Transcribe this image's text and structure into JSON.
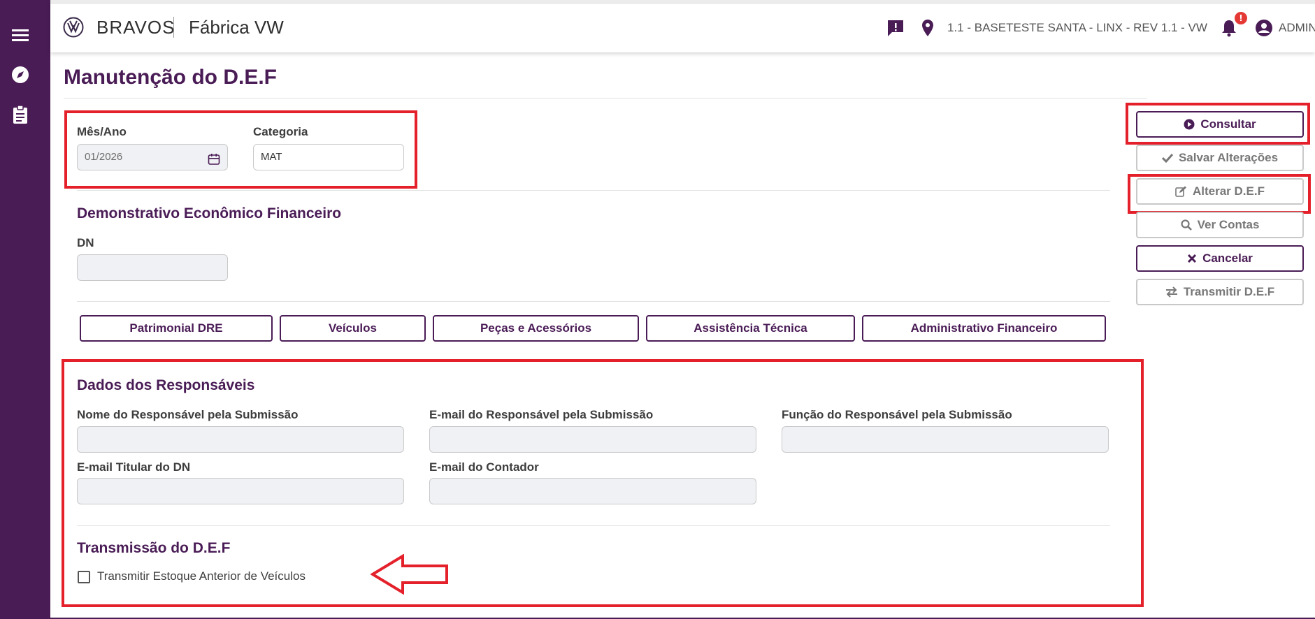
{
  "header": {
    "brand": "BRAVOS",
    "sub_brand": "Fábrica VW",
    "location": "1.1 - BASETESTE SANTA - LINX - REV 1.1 - VW",
    "notification_count": "!",
    "user": "ADMIN"
  },
  "page": {
    "title": "Manutenção do D.E.F"
  },
  "filters": {
    "month_label": "Mês/Ano",
    "month_value": "01/2026",
    "category_label": "Categoria",
    "category_value": "MAT"
  },
  "def_section": {
    "title": "Demonstrativo Econômico Financeiro",
    "dn_label": "DN",
    "dn_value": ""
  },
  "tabs": [
    "Patrimonial DRE",
    "Veículos",
    "Peças e Acessórios",
    "Assistência Técnica",
    "Administrativo Financeiro"
  ],
  "responsaveis": {
    "title": "Dados dos Responsáveis",
    "nome_label": "Nome do Responsável pela Submissão",
    "email_label": "E-mail do Responsável pela Submissão",
    "funcao_label": "Função do Responsável pela Submissão",
    "email_titular_label": "E-mail Titular do DN",
    "email_contador_label": "E-mail do Contador"
  },
  "transmissao": {
    "title": "Transmissão do D.E.F",
    "checkbox_label": "Transmitir Estoque Anterior de Veículos"
  },
  "actions": {
    "consultar": "Consultar",
    "salvar": "Salvar Alterações",
    "alterar": "Alterar D.E.F",
    "ver_contas": "Ver Contas",
    "cancelar": "Cancelar",
    "transmitir": "Transmitir D.E.F"
  },
  "colors": {
    "brand": "#4a1c56",
    "highlight": "#e4212b"
  }
}
